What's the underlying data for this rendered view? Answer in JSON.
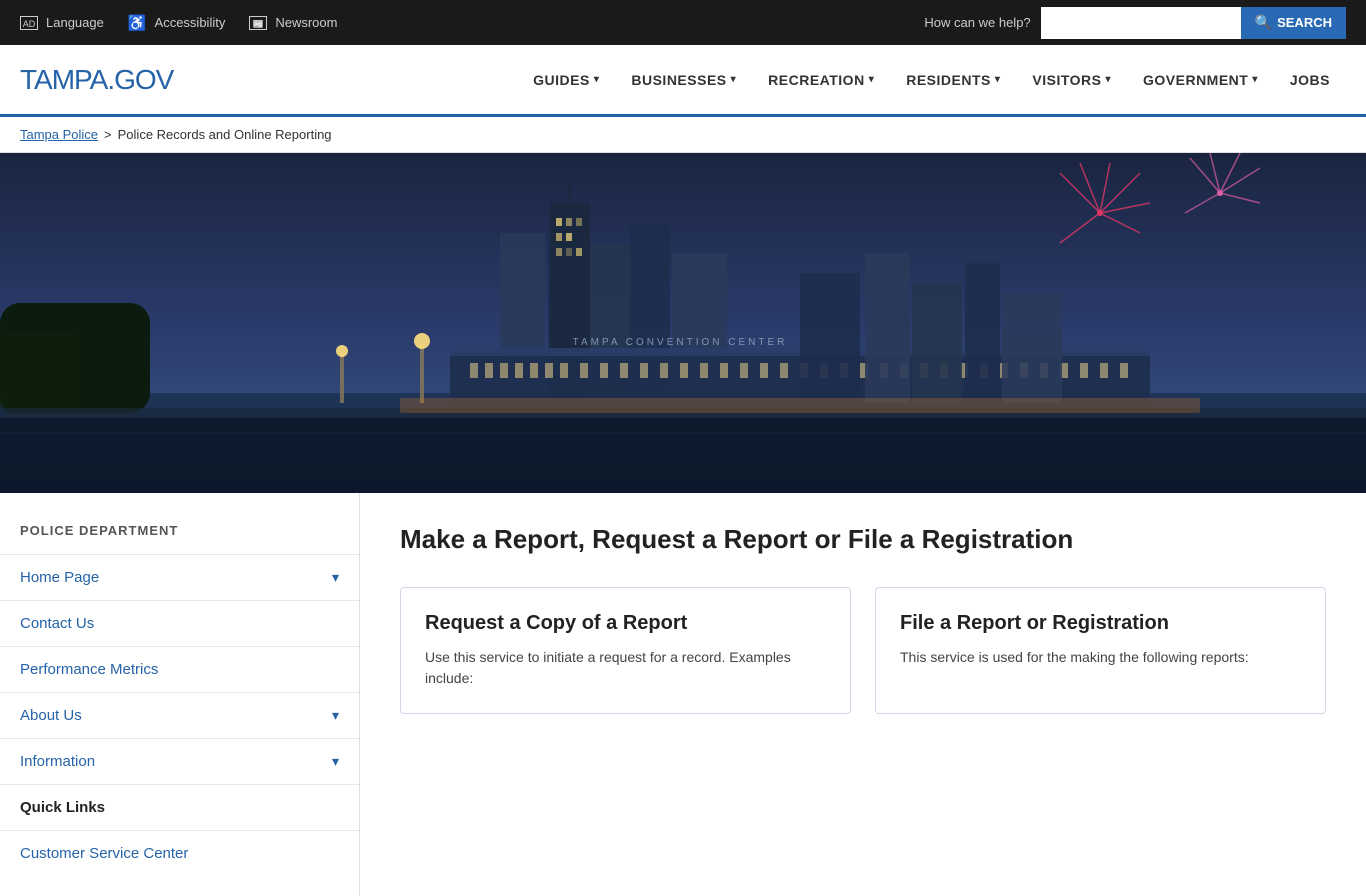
{
  "topbar": {
    "language_label": "Language",
    "accessibility_label": "Accessibility",
    "newsroom_label": "Newsroom",
    "search_prompt": "How can we help?",
    "search_placeholder": "",
    "search_button": "SEARCH"
  },
  "navbar": {
    "logo_main": "TAMPA",
    "logo_sub": ".GOV",
    "nav_items": [
      {
        "label": "GUIDES",
        "has_dropdown": true
      },
      {
        "label": "BUSINESSES",
        "has_dropdown": true
      },
      {
        "label": "RECREATION",
        "has_dropdown": true
      },
      {
        "label": "RESIDENTS",
        "has_dropdown": true
      },
      {
        "label": "VISITORS",
        "has_dropdown": true
      },
      {
        "label": "GOVERNMENT",
        "has_dropdown": true
      },
      {
        "label": "JOBS",
        "has_dropdown": false
      }
    ]
  },
  "breadcrumb": {
    "parent_label": "Tampa Police",
    "separator": ">",
    "current_label": "Police Records and Online Reporting"
  },
  "sidebar": {
    "title": "POLICE DEPARTMENT",
    "items": [
      {
        "label": "Home Page",
        "has_caret": true,
        "bold": false
      },
      {
        "label": "Contact Us",
        "has_caret": false,
        "bold": false
      },
      {
        "label": "Performance Metrics",
        "has_caret": false,
        "bold": false
      },
      {
        "label": "About Us",
        "has_caret": true,
        "bold": false
      },
      {
        "label": "Information",
        "has_caret": true,
        "bold": false
      },
      {
        "label": "Quick Links",
        "has_caret": false,
        "bold": true
      },
      {
        "label": "Customer Service Center",
        "has_caret": false,
        "bold": false
      }
    ]
  },
  "main": {
    "page_title": "Make a Report, Request a Report or File a Registration",
    "card1": {
      "title": "Request a Copy of a Report",
      "text": "Use this service to initiate a request for a record. Examples include:"
    },
    "card2": {
      "title": "File a Report or Registration",
      "text": "This service is used for the making the following reports:"
    }
  }
}
